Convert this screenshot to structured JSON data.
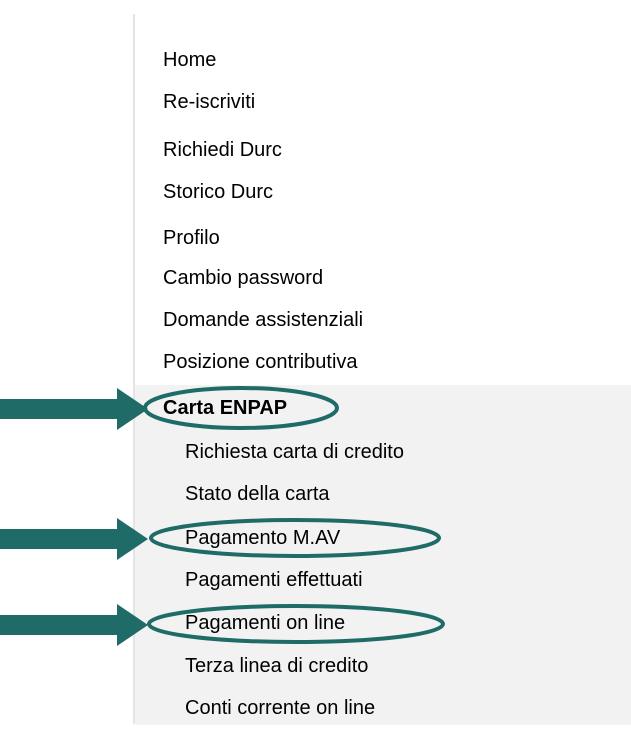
{
  "menu": {
    "items": [
      {
        "label": "Home"
      },
      {
        "label": "Re-iscriviti"
      },
      {
        "label": "Richiedi Durc"
      },
      {
        "label": "Storico Durc"
      },
      {
        "label": "Profilo"
      },
      {
        "label": "Cambio password"
      },
      {
        "label": "Domande assistenziali"
      },
      {
        "label": "Posizione contributiva"
      },
      {
        "label": "Carta ENPAP",
        "active": true
      }
    ],
    "subitems": [
      {
        "label": "Richiesta carta di credito"
      },
      {
        "label": "Stato della carta"
      },
      {
        "label": "Pagamento M.AV",
        "highlighted": true
      },
      {
        "label": "Pagamenti effettuati"
      },
      {
        "label": "Pagamenti on line",
        "highlighted": true
      },
      {
        "label": "Terza linea di credito"
      },
      {
        "label": "Conti corrente on line"
      }
    ]
  },
  "annotations": {
    "arrow_color": "#1f6b67",
    "ellipse_color": "#1f6b67"
  },
  "colors": {
    "active_background": "#f2f2f2",
    "text": "#000000"
  }
}
